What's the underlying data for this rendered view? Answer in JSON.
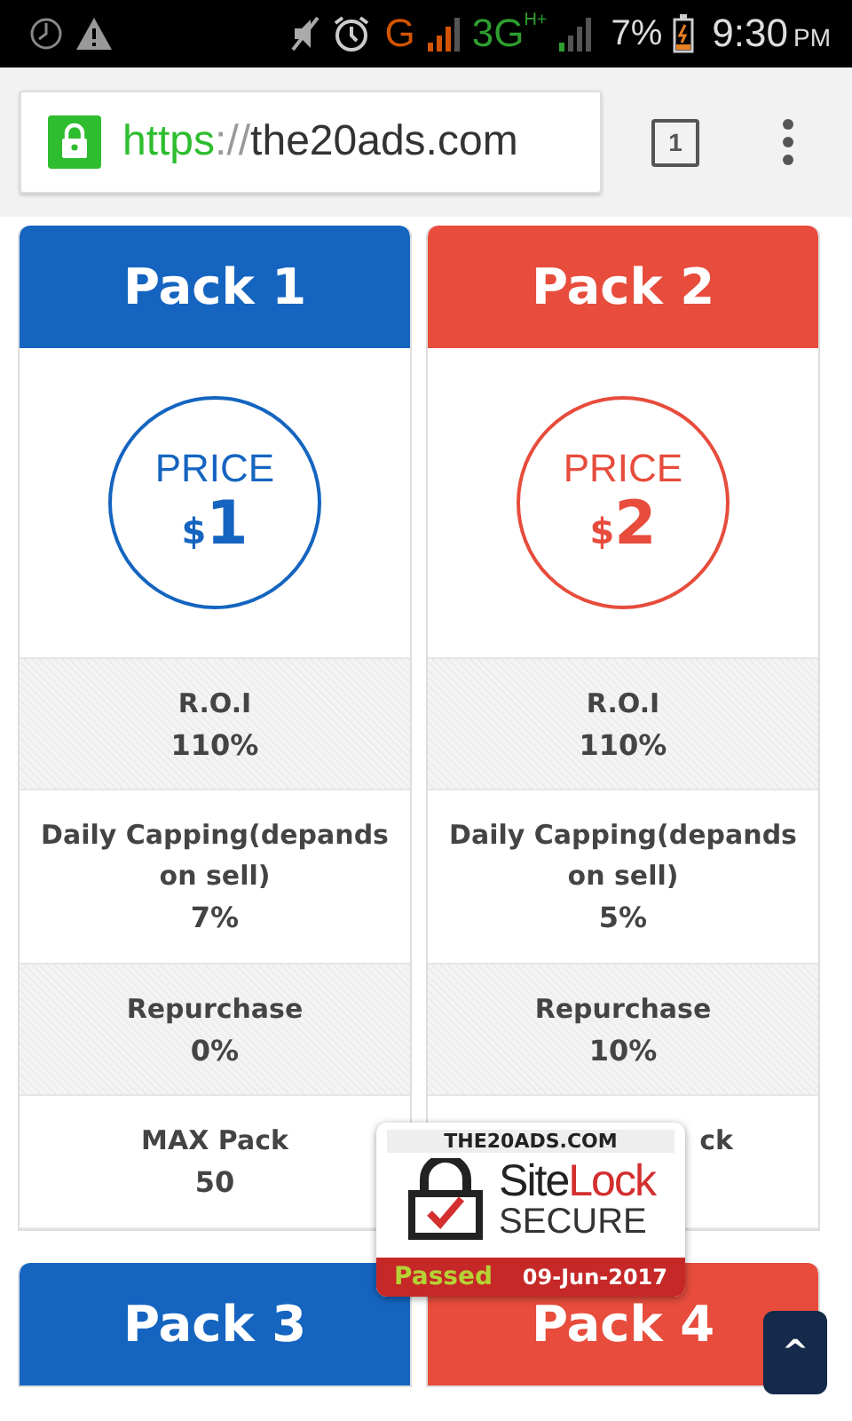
{
  "status_bar": {
    "network": "G",
    "network_2": "3G",
    "network_2_sub": "H+",
    "battery": "7%",
    "time": "9:30",
    "ampm": "PM"
  },
  "browser": {
    "scheme": "https",
    "separator": "://",
    "host": "the20ads.com",
    "tab_count": "1"
  },
  "packs": [
    {
      "title": "Pack 1",
      "color": "#1565c0",
      "price_label": "PRICE",
      "currency": "$",
      "amount": "1",
      "rows": [
        {
          "label": "R.O.I",
          "value": "110%"
        },
        {
          "label": "Daily Capping(depands on sell)",
          "value": "7%"
        },
        {
          "label": "Repurchase",
          "value": "0%"
        },
        {
          "label": "MAX Pack",
          "value": "50"
        }
      ]
    },
    {
      "title": "Pack 2",
      "color": "#e74c3c",
      "price_label": "PRICE",
      "currency": "$",
      "amount": "2",
      "rows": [
        {
          "label": "R.O.I",
          "value": "110%"
        },
        {
          "label": "Daily Capping(depands on sell)",
          "value": "5%"
        },
        {
          "label": "Repurchase",
          "value": "10%"
        },
        {
          "label": "ck"
        }
      ]
    },
    {
      "title": "Pack 3",
      "color": "#1565c0"
    },
    {
      "title": "Pack 4",
      "color": "#e74c3c"
    }
  ],
  "badge": {
    "domain": "THE20ADS.COM",
    "brand_a": "Site",
    "brand_b": "Lock",
    "secure": "SECURE",
    "status": "Passed",
    "date": "09-Jun-2017"
  },
  "scroll_top": {
    "label": "^"
  }
}
